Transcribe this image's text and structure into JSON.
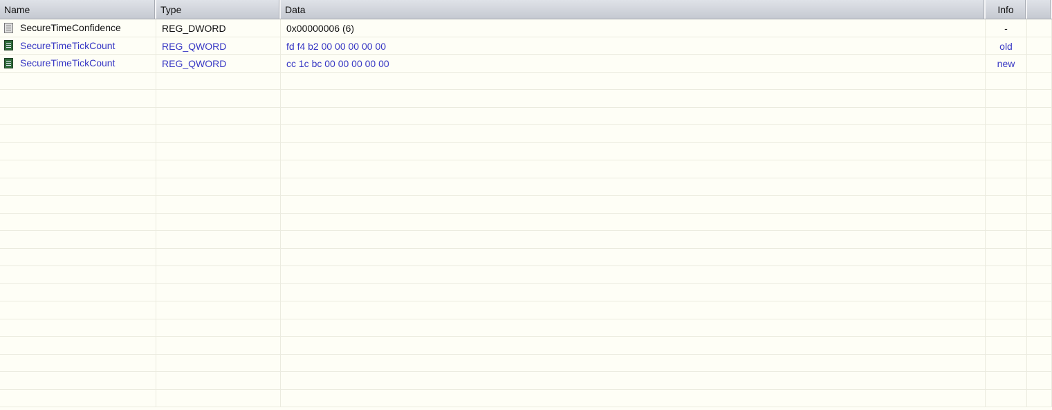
{
  "columns": [
    "Name",
    "Type",
    "Data",
    "Info"
  ],
  "rows": [
    {
      "name": "SecureTimeConfidence",
      "type": "REG_DWORD",
      "data": "0x00000006 (6)",
      "info": "-",
      "icon": "registry-value-icon",
      "highlight": false
    },
    {
      "name": "SecureTimeTickCount",
      "type": "REG_QWORD",
      "data": "fd f4 b2 00 00 00 00 00",
      "info": "old",
      "icon": "registry-binary-value-icon",
      "highlight": true
    },
    {
      "name": "SecureTimeTickCount",
      "type": "REG_QWORD",
      "data": "cc 1c bc 00 00 00 00 00",
      "info": "new",
      "icon": "registry-binary-value-icon",
      "highlight": true
    }
  ],
  "colors": {
    "highlight_text": "#3636c4",
    "background": "#fefef6"
  }
}
